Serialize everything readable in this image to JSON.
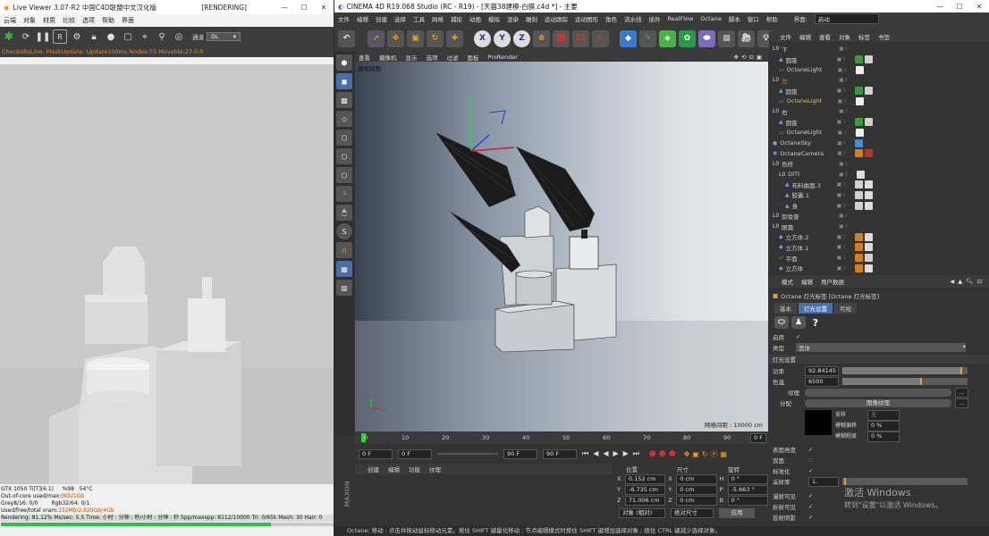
{
  "live_viewer": {
    "title": "Live Viewer 3.07-R2 中国C4D联盟中文汉化版",
    "status_tag": "[RENDERING]",
    "window_controls": [
      "—",
      "☐",
      "✕"
    ],
    "menu": [
      "云端",
      "对象",
      "材质",
      "比较",
      "选项",
      "帮助",
      "界面"
    ],
    "channel_label": "通道",
    "channel_value": "DL",
    "status_line": "CheckIdleLine:  MeshUpdate:  Update100ms  Nodes:73  Movable:27  0:0",
    "stats": [
      {
        "a": "GTX 1050 Ti[T](6.1)",
        "b": "%98",
        "c": "54°C"
      },
      {
        "a": "Out-of-core used/max:",
        "b": "0Kb/1Gb",
        "c": ""
      },
      {
        "a": "Grey8/16: 0/0",
        "b": "Rgb32/64: 0/1",
        "c": ""
      },
      {
        "a": "Used/free/total vram:",
        "b": "332Mb/2.829Gb/4Gb",
        "c": ""
      }
    ],
    "rendering_line": "Rendering: 81.12%  Ms/sec: 5.5    Time: 小时 : 分钟 : 秒/小时 : 分钟 : 秒    Spp/maxspp: 8112/10000    Tri: 0/65k    Mesh: 30    Hair: 0",
    "progress": 0.8112
  },
  "c4d": {
    "title": "CINEMA 4D R19.068 Studio (RC - R19) - [天猫38建模-白膜.c4d *] - 主要",
    "menu": [
      "文件",
      "编辑",
      "创建",
      "选择",
      "工具",
      "网格",
      "捕捉",
      "动画",
      "模拟",
      "渲染",
      "雕刻",
      "运动跟踪",
      "运动图形",
      "角色",
      "流水线",
      "插件",
      "RealFlow",
      "Octane",
      "脚本",
      "窗口",
      "帮助"
    ],
    "layout_label": "界面:",
    "layout_value": "启动",
    "viewport_menu": [
      "查看",
      "摄像机",
      "显示",
      "选项",
      "过滤",
      "面板",
      "ProRender"
    ],
    "viewport_name": "透视视图",
    "grid_spacing": "网格间距 : 10000 cm",
    "timeline_ticks": [
      "0",
      "10",
      "20",
      "30",
      "40",
      "50",
      "60",
      "70",
      "80",
      "90"
    ],
    "frame_end_label": "0 F",
    "frame_fields": [
      "0 F",
      "0 F",
      "90 F",
      "90 F"
    ],
    "bottom_tabs": [
      "创建",
      "编辑",
      "功能",
      "纹理"
    ],
    "coord_headers": [
      "位置",
      "尺寸",
      "旋转"
    ],
    "coords": [
      {
        "axis": "X",
        "pos": "0.152 cm",
        "saxis": "X",
        "size": "0 cm",
        "raxis": "H",
        "rot": "0 °"
      },
      {
        "axis": "Y",
        "pos": "-6.735 cm",
        "saxis": "Y",
        "size": "0 cm",
        "raxis": "P",
        "rot": "-5.663 °"
      },
      {
        "axis": "Z",
        "pos": "71.006 cm",
        "saxis": "Z",
        "size": "0 cm",
        "raxis": "B",
        "rot": "0 °"
      }
    ],
    "coord_mode": "对象 (相对)",
    "coord_size_mode": "绝对尺寸",
    "apply_label": "应用",
    "status_bar": "Octane:   移动 : 点击并拖动鼠标移动元素。按住 SHIFT 键量化移动 ; 节点编辑模式时按住 SHIFT 键增加选择对象 ; 按住 CTRL 键减少选择对象。"
  },
  "objects": {
    "menu": [
      "文件",
      "编辑",
      "查看",
      "对象",
      "标签",
      "书签"
    ],
    "rows": [
      {
        "indent": 0,
        "name": "下",
        "icon": "L0",
        "tags": []
      },
      {
        "indent": 1,
        "name": "圆锥",
        "icon": "cone",
        "tags": [
          "#3a9a3a",
          "#d0d0d0"
        ]
      },
      {
        "indent": 1,
        "name": "OctaneLight",
        "icon": "light",
        "tags": [
          "#eeeeee"
        ]
      },
      {
        "indent": 0,
        "name": "左",
        "icon": "L0",
        "tags": [],
        "color": "#e07020"
      },
      {
        "indent": 1,
        "name": "圆锥",
        "icon": "cone",
        "tags": [
          "#3a9a3a",
          "#d0d0d0"
        ]
      },
      {
        "indent": 1,
        "name": "OctaneLight",
        "icon": "light",
        "tags": [
          "#eeeeee"
        ],
        "color": "#e0c040"
      },
      {
        "indent": 0,
        "name": "右",
        "icon": "L0",
        "tags": []
      },
      {
        "indent": 1,
        "name": "圆锥",
        "icon": "cone",
        "tags": [
          "#3a9a3a",
          "#d0d0d0"
        ]
      },
      {
        "indent": 1,
        "name": "OctaneLight",
        "icon": "light",
        "tags": [
          "#eeeeee"
        ]
      },
      {
        "indent": 0,
        "name": "OctaneSky",
        "icon": "sky",
        "tags": [
          "#4a8ad0"
        ]
      },
      {
        "indent": 0,
        "name": "OctaneCamera",
        "icon": "cam",
        "tags": [
          "#d08020",
          "#c03030"
        ]
      },
      {
        "indent": 0,
        "name": "色修",
        "icon": "L0",
        "tags": []
      },
      {
        "indent": 1,
        "name": "DITI",
        "icon": "L0",
        "tags": [
          "#dddddd"
        ]
      },
      {
        "indent": 2,
        "name": "布料曲面.3",
        "icon": "obj",
        "tags": [
          "#d0d0d0",
          "#dddddd"
        ]
      },
      {
        "indent": 2,
        "name": "胶囊.1",
        "icon": "obj",
        "tags": [
          "#d0d0d0",
          "#dddddd"
        ]
      },
      {
        "indent": 2,
        "name": "身",
        "icon": "obj",
        "tags": [
          "#d0d0d0",
          "#dddddd"
        ]
      },
      {
        "indent": 0,
        "name": "卸妆膏",
        "icon": "L0",
        "tags": []
      },
      {
        "indent": 0,
        "name": "眼霜",
        "icon": "L0",
        "tags": []
      },
      {
        "indent": 1,
        "name": "立方体.2",
        "icon": "cube",
        "tags": [
          "#d08020",
          "#dddddd"
        ]
      },
      {
        "indent": 1,
        "name": "立方体.1",
        "icon": "cube",
        "tags": [
          "#d08020",
          "#dddddd"
        ]
      },
      {
        "indent": 1,
        "name": "平面",
        "icon": "plane",
        "tags": [
          "#d08020",
          "#d0d0d0"
        ]
      },
      {
        "indent": 1,
        "name": "立方体",
        "icon": "cube",
        "tags": [
          "#d08020",
          "#dddddd"
        ]
      }
    ]
  },
  "attributes": {
    "menu": [
      "模式",
      "编辑",
      "用户数据"
    ],
    "tag_title": "Octane 灯光标签 [Octane 灯光标签]",
    "tabs": [
      "基本",
      "灯光设置",
      "可视"
    ],
    "enable_label": "启用",
    "type_label": "类型",
    "type_value": "黑体",
    "section": "灯光设置",
    "power_label": "功率",
    "power_value": "92.84145",
    "power_fraction": 0.94,
    "temp_label": "色温",
    "temp_value": "6500",
    "temp_fraction": 0.62,
    "texture_label": "纹理",
    "distribution_label": "分配",
    "image_texture": "图像纹理",
    "sampling_label": "采样",
    "blend_offset_label": "模糊偏移",
    "blend_offset_value": "0 %",
    "blend_level_label": "模糊程度",
    "blend_level_value": "0 %",
    "surface_label": "表面亮度",
    "double_label": "双面",
    "normalize_label": "标准化",
    "sample_rate_label": "采样率",
    "sample_rate_value": "1.",
    "camera_vis_label": "漫射可见",
    "refract_vis_label": "折射可见",
    "shadow_vis_label": "投射阴影"
  },
  "watermark": {
    "line1": "激活 Windows",
    "line2": "转到\"设置\"以激活 Windows。"
  },
  "colors": {
    "accent_orange": "#f0a020",
    "ui_dark": "#333333",
    "selected_blue": "#4a6ea8"
  }
}
